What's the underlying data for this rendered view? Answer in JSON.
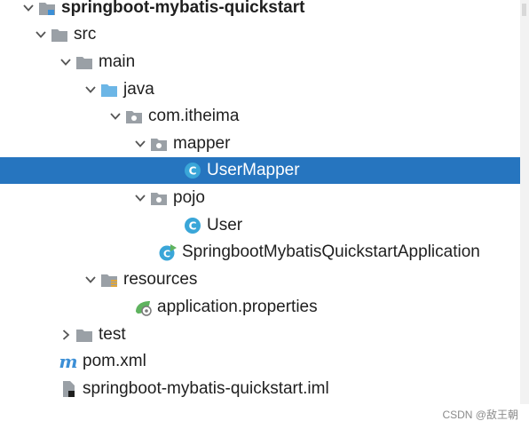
{
  "project_tree": {
    "root": "springboot-mybatis-quickstart",
    "src": "src",
    "main": "main",
    "java": "java",
    "package": "com.itheima",
    "mapper": "mapper",
    "user_mapper": "UserMapper",
    "pojo": "pojo",
    "user": "User",
    "application_class": "SpringbootMybatisQuickstartApplication",
    "resources": "resources",
    "application_properties": "application.properties",
    "test": "test",
    "pom": "pom.xml",
    "iml": "springboot-mybatis-quickstart.iml"
  },
  "selected_item": "UserMapper",
  "colors": {
    "selection": "#2675bf",
    "folder": "#9aa0a6",
    "source_folder": "#6cb6e6",
    "class_icon": "#3aa6d8",
    "spring_leaf": "#5fb35f",
    "maven": "#3c8fd6"
  },
  "icons": {
    "collapsed": "chevron-right",
    "expanded": "chevron-down"
  },
  "watermark": "CSDN @敌王朝"
}
